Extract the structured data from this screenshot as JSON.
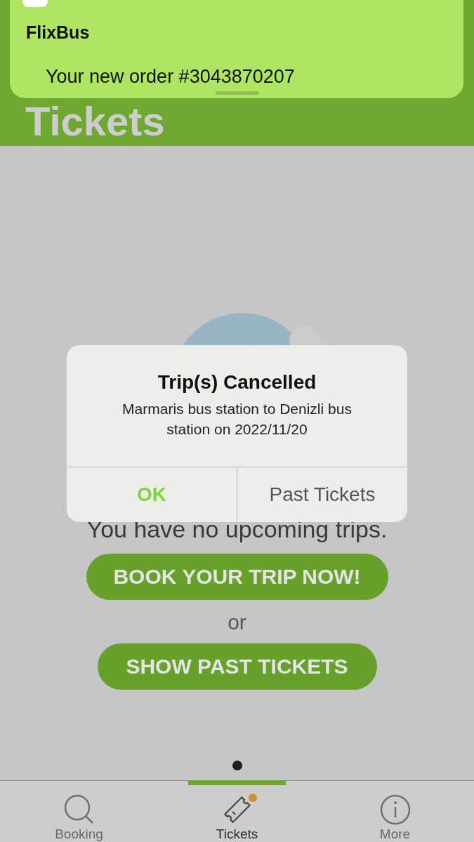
{
  "header": {
    "title": "Tickets"
  },
  "notification": {
    "app": "FlixBus",
    "message": "Your new order #3043870207"
  },
  "empty_state": {
    "message": "You have no upcoming trips.",
    "primary_button": "BOOK YOUR TRIP NOW!",
    "separator": "or",
    "secondary_button": "SHOW PAST TICKETS"
  },
  "page_dots": [
    {
      "selected": true
    }
  ],
  "dialog": {
    "title": "Trip(s) Cancelled",
    "message": "Marmaris bus station to Denizli bus station on 2022/11/20",
    "buttons": [
      {
        "label": "OK",
        "kind": "primary"
      },
      {
        "label": "Past Tickets",
        "kind": "secondary"
      }
    ]
  },
  "tab_bar": [
    {
      "label": "Booking",
      "selected": false,
      "badge": false
    },
    {
      "label": "Tickets",
      "selected": true,
      "badge": true
    },
    {
      "label": "More",
      "selected": false,
      "badge": false
    }
  ]
}
